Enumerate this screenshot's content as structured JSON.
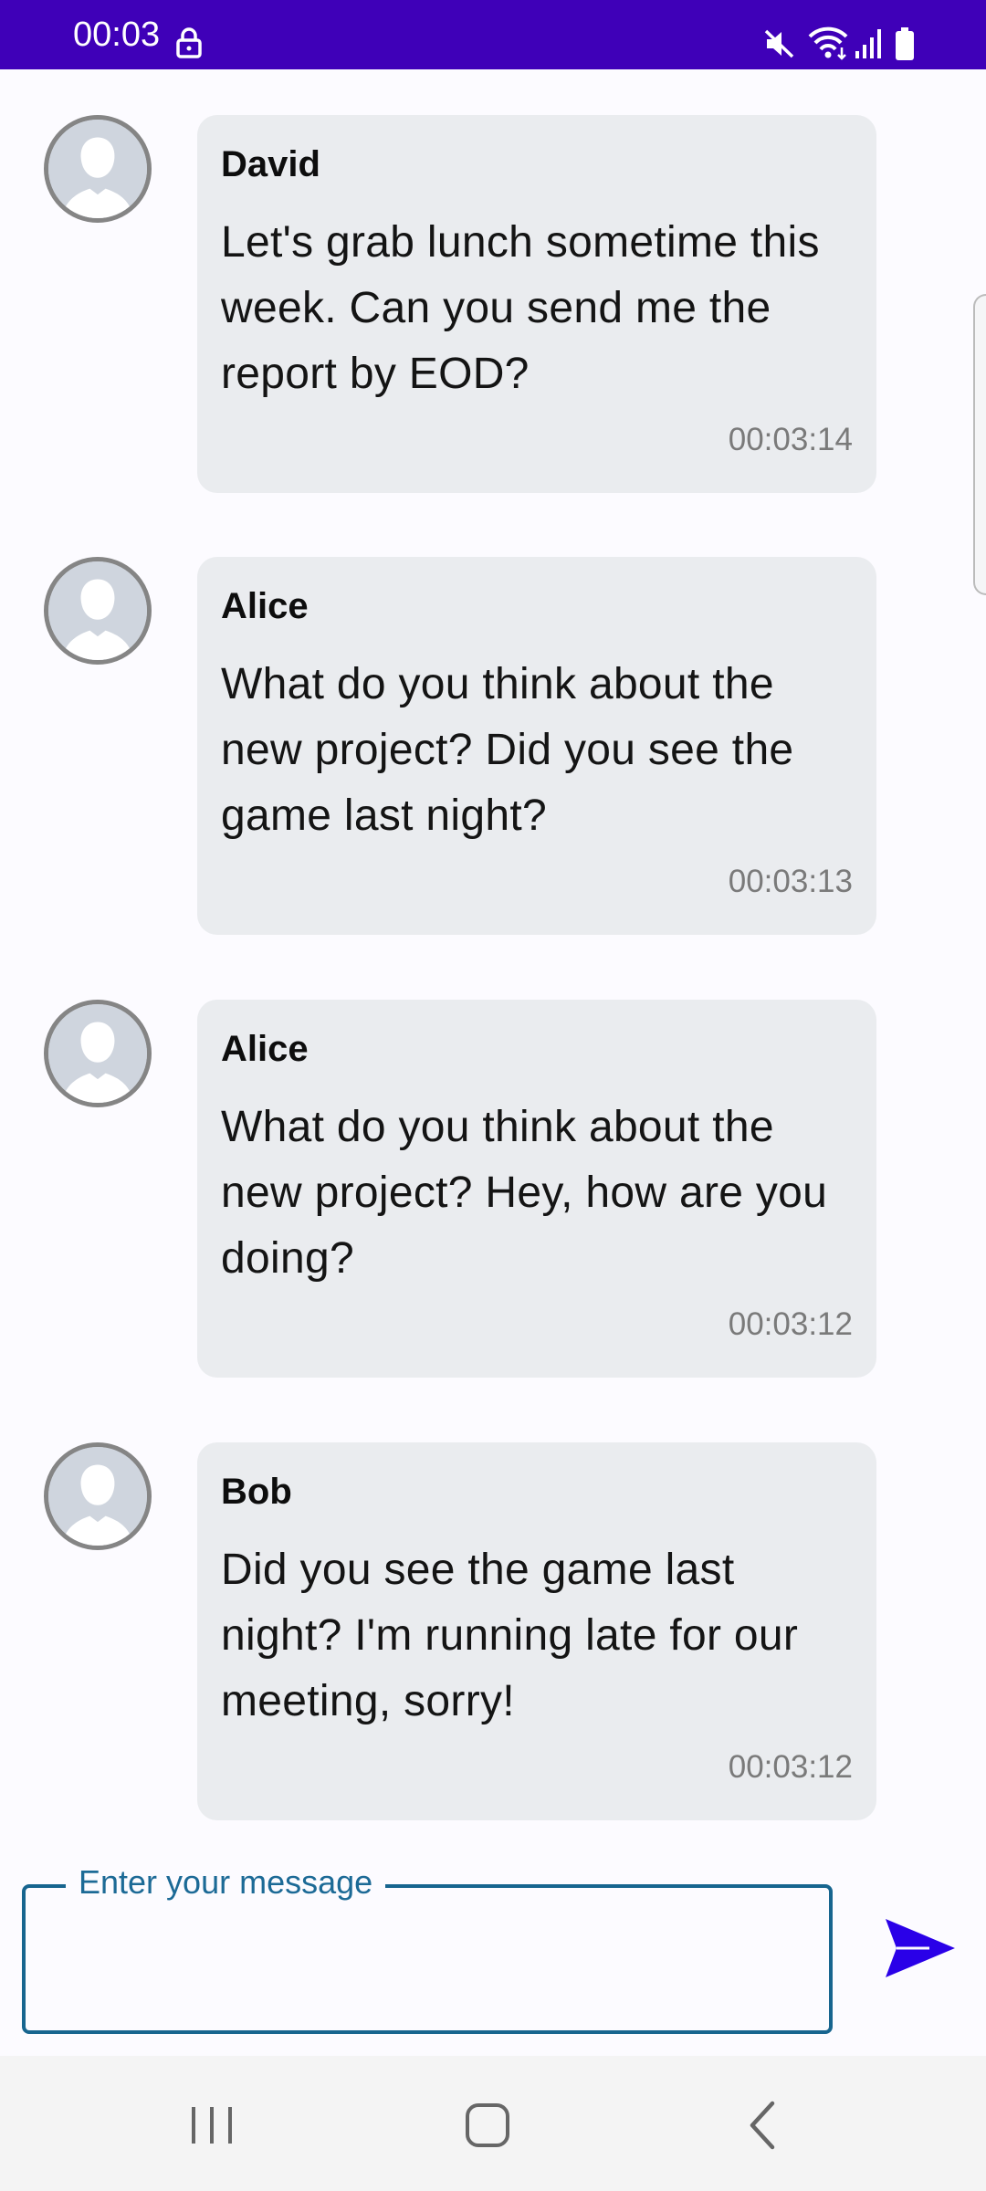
{
  "status_bar": {
    "time": "00:03",
    "icons": [
      "lock-icon",
      "mute-icon",
      "wifi-icon",
      "signal-icon",
      "battery-icon"
    ],
    "background": "#3f00b8"
  },
  "messages": [
    {
      "sender": "David",
      "text": "Let's grab lunch sometime this week. Can you send me the report by EOD?",
      "time": "00:03:14",
      "avatar_icon": "person-avatar-icon"
    },
    {
      "sender": "Alice",
      "text": "What do you think about the new project? Did you see the game last night?",
      "time": "00:03:13",
      "avatar_icon": "person-avatar-icon"
    },
    {
      "sender": "Alice",
      "text": "What do you think about the new project? Hey, how are you doing?",
      "time": "00:03:12",
      "avatar_icon": "person-avatar-icon"
    },
    {
      "sender": "Bob",
      "text": "Did you see the game last night? I'm running late for our meeting, sorry!",
      "time": "00:03:12",
      "avatar_icon": "person-avatar-icon"
    }
  ],
  "composer": {
    "label": "Enter your message",
    "value": "",
    "send_icon": "send-icon",
    "accent": "#17658f",
    "send_color": "#2a00e8"
  },
  "nav_bar": {
    "icons": [
      "recents-icon",
      "home-icon",
      "back-icon"
    ]
  },
  "colors": {
    "bubble": "#eaecef",
    "timestamp": "#7a7a7a"
  }
}
